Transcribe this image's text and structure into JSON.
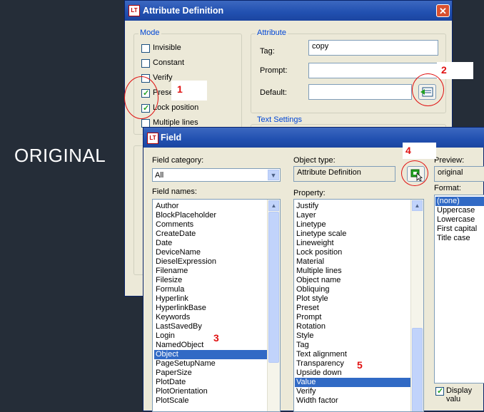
{
  "overlay_label": "ORIGINAL",
  "attribute_dialog": {
    "title": "Attribute Definition",
    "app_icon": "autocad-lt-icon",
    "mode": {
      "label": "Mode",
      "options": [
        {
          "label": "Invisible",
          "checked": false
        },
        {
          "label": "Constant",
          "checked": false
        },
        {
          "label": "Verify",
          "checked": false
        },
        {
          "label": "Preset",
          "checked": true
        },
        {
          "label": "Lock position",
          "checked": true
        },
        {
          "label": "Multiple lines",
          "checked": false
        }
      ]
    },
    "attribute": {
      "label": "Attribute",
      "tag_label": "Tag:",
      "tag_value": "copy",
      "prompt_label": "Prompt:",
      "prompt_value": "",
      "default_label": "Default:",
      "default_value": "",
      "insert_field_icon": "insert-field-icon"
    },
    "text_settings_label": "Text Settings"
  },
  "annotations": {
    "n1": "1",
    "n2": "2",
    "n3": "3",
    "n4": "4",
    "n5": "5",
    "color": "#e01010"
  },
  "field_dialog": {
    "title": "Field",
    "field_category_label": "Field category:",
    "field_category_value": "All",
    "field_names_label": "Field names:",
    "field_names": [
      "Author",
      "BlockPlaceholder",
      "Comments",
      "CreateDate",
      "Date",
      "DeviceName",
      "DieselExpression",
      "Filename",
      "Filesize",
      "Formula",
      "Hyperlink",
      "HyperlinkBase",
      "Keywords",
      "LastSavedBy",
      "Login",
      "NamedObject",
      "Object",
      "PageSetupName",
      "PaperSize",
      "PlotDate",
      "PlotOrientation",
      "PlotScale"
    ],
    "field_names_selected": "Object",
    "object_type_label": "Object type:",
    "object_type_value": "Attribute Definition",
    "select_object_icon": "select-object-icon",
    "property_label": "Property:",
    "properties": [
      "Justify",
      "Layer",
      "Linetype",
      "Linetype scale",
      "Lineweight",
      "Lock position",
      "Material",
      "Multiple lines",
      "Object name",
      "Obliquing",
      "Plot style",
      "Preset",
      "Prompt",
      "Rotation",
      "Style",
      "Tag",
      "Text alignment",
      "Transparency",
      "Upside down",
      "Value",
      "Verify",
      "Width factor"
    ],
    "property_selected": "Value",
    "preview_label": "Preview:",
    "preview_value": "original",
    "format_label": "Format:",
    "formats": [
      "(none)",
      "Uppercase",
      "Lowercase",
      "First capital",
      "Title case"
    ],
    "format_selected": "(none)",
    "display_value_label": "Display valu",
    "display_value_checked": true
  },
  "colors": {
    "desktop_bg": "#252d38",
    "titlebar": "#2150b0",
    "dialog_bg": "#ece9d8",
    "selection": "#316ac5",
    "group_label": "#0046d5"
  }
}
